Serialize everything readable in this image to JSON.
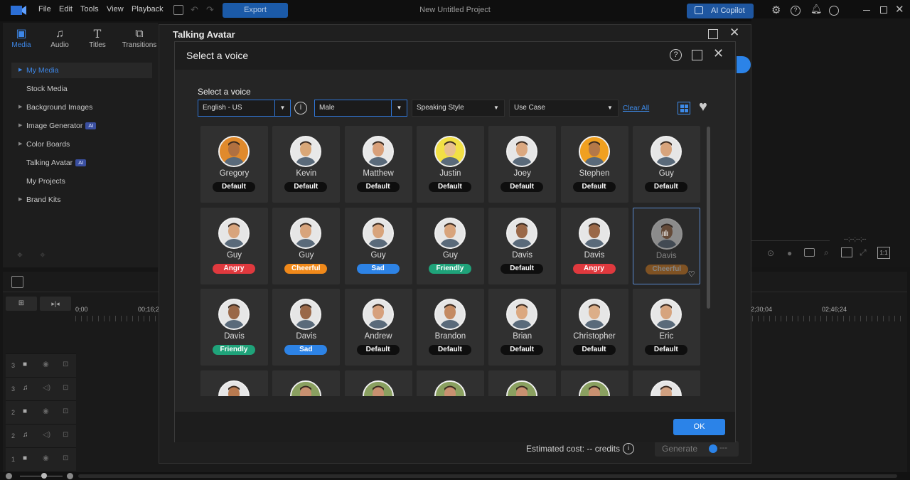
{
  "menu": [
    "File",
    "Edit",
    "Tools",
    "View",
    "Playback"
  ],
  "export_label": "Export",
  "project_title": "New Untitled Project",
  "copilot_label": "AI Copilot",
  "left_tabs": [
    "Media",
    "Audio",
    "Titles",
    "Transitions"
  ],
  "left_items": [
    {
      "label": "My Media",
      "ai": ""
    },
    {
      "label": "Stock Media",
      "ai": ""
    },
    {
      "label": "Background Images",
      "ai": ""
    },
    {
      "label": "Image Generator",
      "ai": "AI"
    },
    {
      "label": "Color Boards",
      "ai": ""
    },
    {
      "label": "Talking Avatar",
      "ai": "AI"
    },
    {
      "label": "My Projects",
      "ai": ""
    },
    {
      "label": "Brand Kits",
      "ai": ""
    }
  ],
  "timeline": {
    "t0": "0;00",
    "t1": "00;16;2",
    "t2": "2;30;04",
    "t3": "02;46;24",
    "tracks": [
      "3",
      "3",
      "2",
      "2",
      "1"
    ]
  },
  "right_counter": "--;--;--;--",
  "ratio": "1:1",
  "talking_avatar": {
    "title": "Talking Avatar",
    "cost": "Estimated cost: -- credits",
    "generate": "Generate",
    "gen_credits": "---"
  },
  "select_voice": {
    "title": "Select a voice",
    "subtitle": "Select a voice",
    "language": "English - US",
    "gender": "Male",
    "style": "Speaking Style",
    "usecase": "Use Case",
    "clear": "Clear All",
    "ok": "OK"
  },
  "tag_colors": {
    "Default": "#0e0e0e",
    "Angry": "#e0393e",
    "Cheerful": "#f0891a",
    "Sad": "#2d83e6",
    "Friendly": "#1fa37a"
  },
  "voices": [
    {
      "name": "Gregory",
      "tag": "Default",
      "bg": "#e08a2c",
      "skin": "#b07040"
    },
    {
      "name": "Kevin",
      "tag": "Default",
      "bg": "#e8e8e8",
      "skin": "#d9a778"
    },
    {
      "name": "Matthew",
      "tag": "Default",
      "bg": "#e8e8e8",
      "skin": "#d9a07a"
    },
    {
      "name": "Justin",
      "tag": "Default",
      "bg": "#f2e045",
      "skin": "#e8c090"
    },
    {
      "name": "Joey",
      "tag": "Default",
      "bg": "#e6e6e6",
      "skin": "#dba880"
    },
    {
      "name": "Stephen",
      "tag": "Default",
      "bg": "#f0a020",
      "skin": "#b47848"
    },
    {
      "name": "Guy",
      "tag": "Default",
      "bg": "#e6e6e6",
      "skin": "#d8a47c"
    },
    {
      "name": "Guy",
      "tag": "Angry",
      "bg": "#e6e6e6",
      "skin": "#d8a47c"
    },
    {
      "name": "Guy",
      "tag": "Cheerful",
      "bg": "#e6e6e6",
      "skin": "#d8a47c"
    },
    {
      "name": "Guy",
      "tag": "Sad",
      "bg": "#e6e6e6",
      "skin": "#d8a47c"
    },
    {
      "name": "Guy",
      "tag": "Friendly",
      "bg": "#e6e6e6",
      "skin": "#d8a47c"
    },
    {
      "name": "Davis",
      "tag": "Default",
      "bg": "#e6e6e6",
      "skin": "#9a6848"
    },
    {
      "name": "Davis",
      "tag": "Angry",
      "bg": "#e6e6e6",
      "skin": "#9a6848"
    },
    {
      "name": "Davis",
      "tag": "Cheerful",
      "bg": "#e6e6e6",
      "skin": "#9a6848"
    },
    {
      "name": "Davis",
      "tag": "Friendly",
      "bg": "#e6e6e6",
      "skin": "#9a6848"
    },
    {
      "name": "Davis",
      "tag": "Sad",
      "bg": "#e6e6e6",
      "skin": "#9a6848"
    },
    {
      "name": "Andrew",
      "tag": "Default",
      "bg": "#e6e6e6",
      "skin": "#d6a07c"
    },
    {
      "name": "Brandon",
      "tag": "Default",
      "bg": "#e6e6e6",
      "skin": "#c48a62"
    },
    {
      "name": "Brian",
      "tag": "Default",
      "bg": "#e6e6e6",
      "skin": "#dba880"
    },
    {
      "name": "Christopher",
      "tag": "Default",
      "bg": "#e6e6e6",
      "skin": "#dcae88"
    },
    {
      "name": "Eric",
      "tag": "Default",
      "bg": "#e6e6e6",
      "skin": "#d6a47e"
    },
    {
      "name": "",
      "tag": "",
      "bg": "#e6e6e6",
      "skin": "#b87a50"
    },
    {
      "name": "",
      "tag": "",
      "bg": "#8aa060",
      "skin": "#c89070"
    },
    {
      "name": "",
      "tag": "",
      "bg": "#8aa060",
      "skin": "#c89070"
    },
    {
      "name": "",
      "tag": "",
      "bg": "#8aa060",
      "skin": "#c89070"
    },
    {
      "name": "",
      "tag": "",
      "bg": "#8aa060",
      "skin": "#c89070"
    },
    {
      "name": "",
      "tag": "",
      "bg": "#8aa060",
      "skin": "#c89070"
    },
    {
      "name": "",
      "tag": "",
      "bg": "#e6e6e6",
      "skin": "#d0a080"
    }
  ],
  "selected_index": 13
}
